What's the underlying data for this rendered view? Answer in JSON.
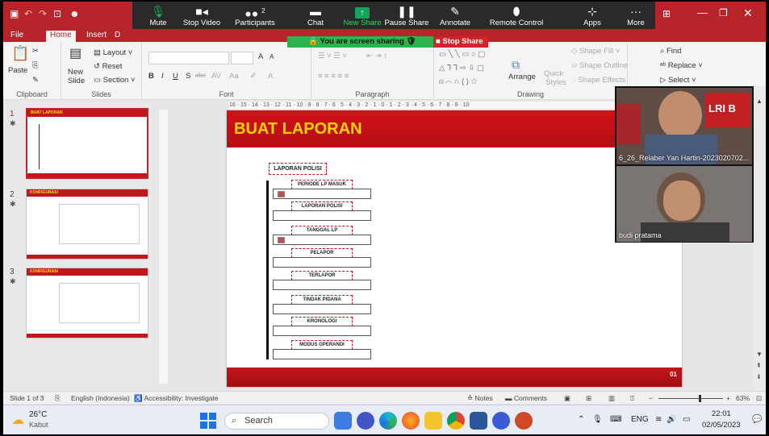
{
  "zoom": {
    "items": [
      {
        "label": "Mute",
        "icon": "microphone-icon"
      },
      {
        "label": "Stop Video",
        "icon": "camera-icon"
      },
      {
        "label": "Participants",
        "icon": "people-icon",
        "count": "2"
      },
      {
        "label": "Chat",
        "icon": "chat-icon"
      },
      {
        "label": "New Share",
        "icon": "share-arrow-icon"
      },
      {
        "label": "Pause Share",
        "icon": "pause-icon"
      },
      {
        "label": "Annotate",
        "icon": "pen-icon"
      },
      {
        "label": "Remote Control",
        "icon": "mouse-icon"
      },
      {
        "label": "Apps",
        "icon": "apps-icon"
      },
      {
        "label": "More",
        "icon": "more-dots-icon"
      }
    ],
    "sharing_text": "You are screen sharing",
    "stop_share": "Stop Share",
    "accent": "#2fb24c"
  },
  "tabs": {
    "file": "File",
    "home": "Home",
    "insert": "Insert",
    "d": "D"
  },
  "ribbon": {
    "clipboard": {
      "paste": "Paste",
      "group": "Clipboard"
    },
    "slides": {
      "new_slide_1": "New",
      "new_slide_2": "Slide",
      "layout": "Layout",
      "reset": "Reset",
      "section": "Section",
      "group": "Slides"
    },
    "font": {
      "group": "Font",
      "bold": "B",
      "italic": "I",
      "underline": "U",
      "shadow": "S",
      "strike": "abc",
      "spacing": "AV",
      "case": "Aa",
      "grow": "A",
      "shrink": "A"
    },
    "paragraph": {
      "group": "Paragraph"
    },
    "drawing": {
      "group": "Drawing",
      "arrange": "Arrange",
      "quick1": "Quick",
      "quick2": "Styles",
      "fill": "Shape Fill",
      "outline": "Shape Outline",
      "effects": "Shape Effects"
    },
    "editing": {
      "find": "Find",
      "replace": "Replace",
      "select": "Select"
    }
  },
  "ruler": {
    "h": "16 · 15 · 14 · 13 · 12 · 11 · 10 · 9 · 8 · 7 · 6 · 5 · 4 · 3 · 2 · 1 · 0 · 1 · 2 · 3 · 4 · 5 · 6 · 7 · 8 · 9 · 10"
  },
  "thumbs": [
    {
      "num": "1",
      "title": "BUAT LAPORAN"
    },
    {
      "num": "2",
      "title": "KONFIGURASI"
    },
    {
      "num": "3",
      "title": "KONFIGURASI"
    }
  ],
  "slide": {
    "title": "BUAT LAPORAN",
    "box_title": "LAPORAN POLISI",
    "fields": [
      "PERIODE LP MASUK",
      "LAPORAN POLISI",
      "TANGGAL LP",
      "PELAPOR",
      "TERLAPOR",
      "TINDAK PIDANA",
      "KRONOLOGI",
      "MODUS OPERANDI"
    ],
    "footer_mark": "01"
  },
  "video": {
    "p1": "6_26_Relaber Yan Hartin-2023020702...",
    "p1_badge": "LRI B",
    "p2": "budi pratama"
  },
  "status": {
    "slide": "Slide 1 of 3",
    "lang": "English (Indonesia)",
    "access": "Accessibility: Investigate",
    "notes": "Notes",
    "comments": "Comments",
    "zoom": "63%",
    "zoom_level": 0.63
  },
  "taskbar": {
    "temp": "26°C",
    "weather": "Kabut",
    "search": "Search",
    "lang": "ENG",
    "time": "22:01",
    "date": "02/05/2023"
  }
}
